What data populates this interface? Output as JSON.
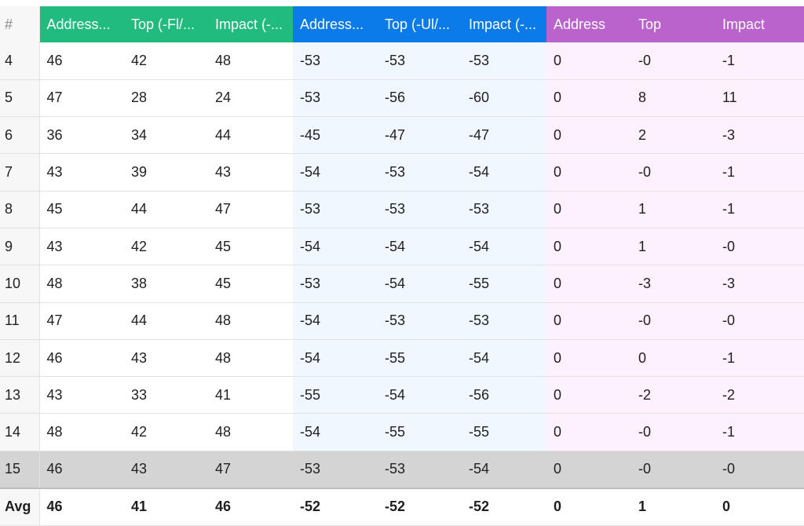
{
  "index_header": "#",
  "groups": [
    {
      "columns": [
        "Address...",
        "Top (-Fl/...",
        "Impact (-..."
      ],
      "color": "#21bb7d",
      "cell_tint": "#ffffff"
    },
    {
      "columns": [
        "Address...",
        "Top (-Ul/...",
        "Impact (-..."
      ],
      "color": "#0a7be8",
      "cell_tint": "#f1f7fe"
    },
    {
      "columns": [
        "Address",
        "Top",
        "Impact"
      ],
      "color": "#bb63cd",
      "cell_tint": "#fdf1fd"
    }
  ],
  "rows": [
    {
      "id": "4",
      "values": [
        "46",
        "42",
        "48",
        "-53",
        "-53",
        "-53",
        "0",
        "-0",
        "-1"
      ]
    },
    {
      "id": "5",
      "values": [
        "47",
        "28",
        "24",
        "-53",
        "-56",
        "-60",
        "0",
        "8",
        "11"
      ]
    },
    {
      "id": "6",
      "values": [
        "36",
        "34",
        "44",
        "-45",
        "-47",
        "-47",
        "0",
        "2",
        "-3"
      ]
    },
    {
      "id": "7",
      "values": [
        "43",
        "39",
        "43",
        "-54",
        "-53",
        "-54",
        "0",
        "-0",
        "-1"
      ]
    },
    {
      "id": "8",
      "values": [
        "45",
        "44",
        "47",
        "-53",
        "-53",
        "-53",
        "0",
        "1",
        "-1"
      ]
    },
    {
      "id": "9",
      "values": [
        "43",
        "42",
        "45",
        "-54",
        "-54",
        "-54",
        "0",
        "1",
        "-0"
      ]
    },
    {
      "id": "10",
      "values": [
        "48",
        "38",
        "45",
        "-53",
        "-54",
        "-55",
        "0",
        "-3",
        "-3"
      ]
    },
    {
      "id": "11",
      "values": [
        "47",
        "44",
        "48",
        "-54",
        "-53",
        "-53",
        "0",
        "-0",
        "-0"
      ]
    },
    {
      "id": "12",
      "values": [
        "46",
        "43",
        "48",
        "-54",
        "-55",
        "-54",
        "0",
        "0",
        "-1"
      ]
    },
    {
      "id": "13",
      "values": [
        "43",
        "33",
        "41",
        "-55",
        "-54",
        "-56",
        "0",
        "-2",
        "-2"
      ]
    },
    {
      "id": "14",
      "values": [
        "48",
        "42",
        "48",
        "-54",
        "-55",
        "-55",
        "0",
        "-0",
        "-1"
      ]
    },
    {
      "id": "15",
      "values": [
        "46",
        "43",
        "47",
        "-53",
        "-53",
        "-54",
        "0",
        "-0",
        "-0"
      ],
      "selected": true
    }
  ],
  "footer": {
    "label": "Avg",
    "values": [
      "46",
      "41",
      "46",
      "-52",
      "-52",
      "-52",
      "0",
      "1",
      "0"
    ]
  }
}
